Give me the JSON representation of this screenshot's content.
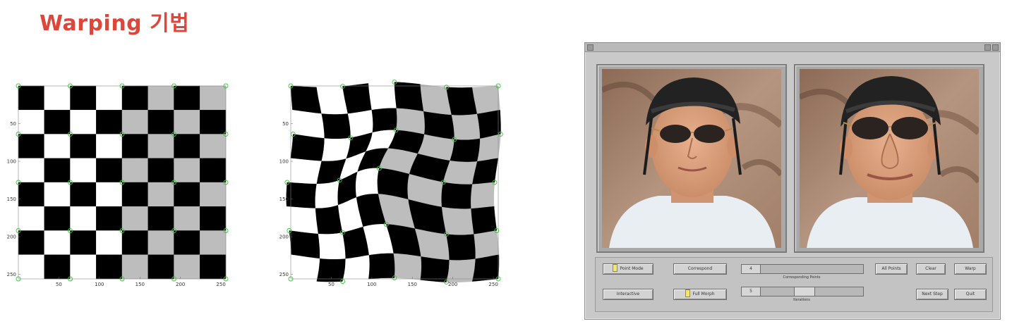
{
  "slide": {
    "title": "Warping 기법"
  },
  "plots": {
    "left": {
      "y_ticks": [
        "50",
        "100",
        "150",
        "200",
        "250"
      ],
      "x_ticks": [
        "50",
        "100",
        "150",
        "200",
        "250"
      ]
    },
    "right": {
      "y_ticks": [
        "50",
        "100",
        "150",
        "200",
        "250"
      ],
      "x_ticks": [
        "50",
        "100",
        "150",
        "200",
        "250"
      ]
    },
    "colors": {
      "dark": "#000000",
      "light_left_half": "#ffffff",
      "light_right_half": "#bdbdbd",
      "control_point": "#3cc63c"
    }
  },
  "tool_window": {
    "buttons": {
      "point_mode": "Point Mode",
      "interactive": "Interactive",
      "correspond": "Correspond",
      "full_morph": "Full Morph",
      "all_points": "All Points",
      "clear": "Clear",
      "warp": "Warp",
      "next_step": "Next Step",
      "quit": "Quit"
    },
    "sliders": {
      "points": {
        "value": "4",
        "caption": "Corresponding Points"
      },
      "iterations": {
        "value": "5",
        "caption": "Iterations"
      }
    }
  }
}
